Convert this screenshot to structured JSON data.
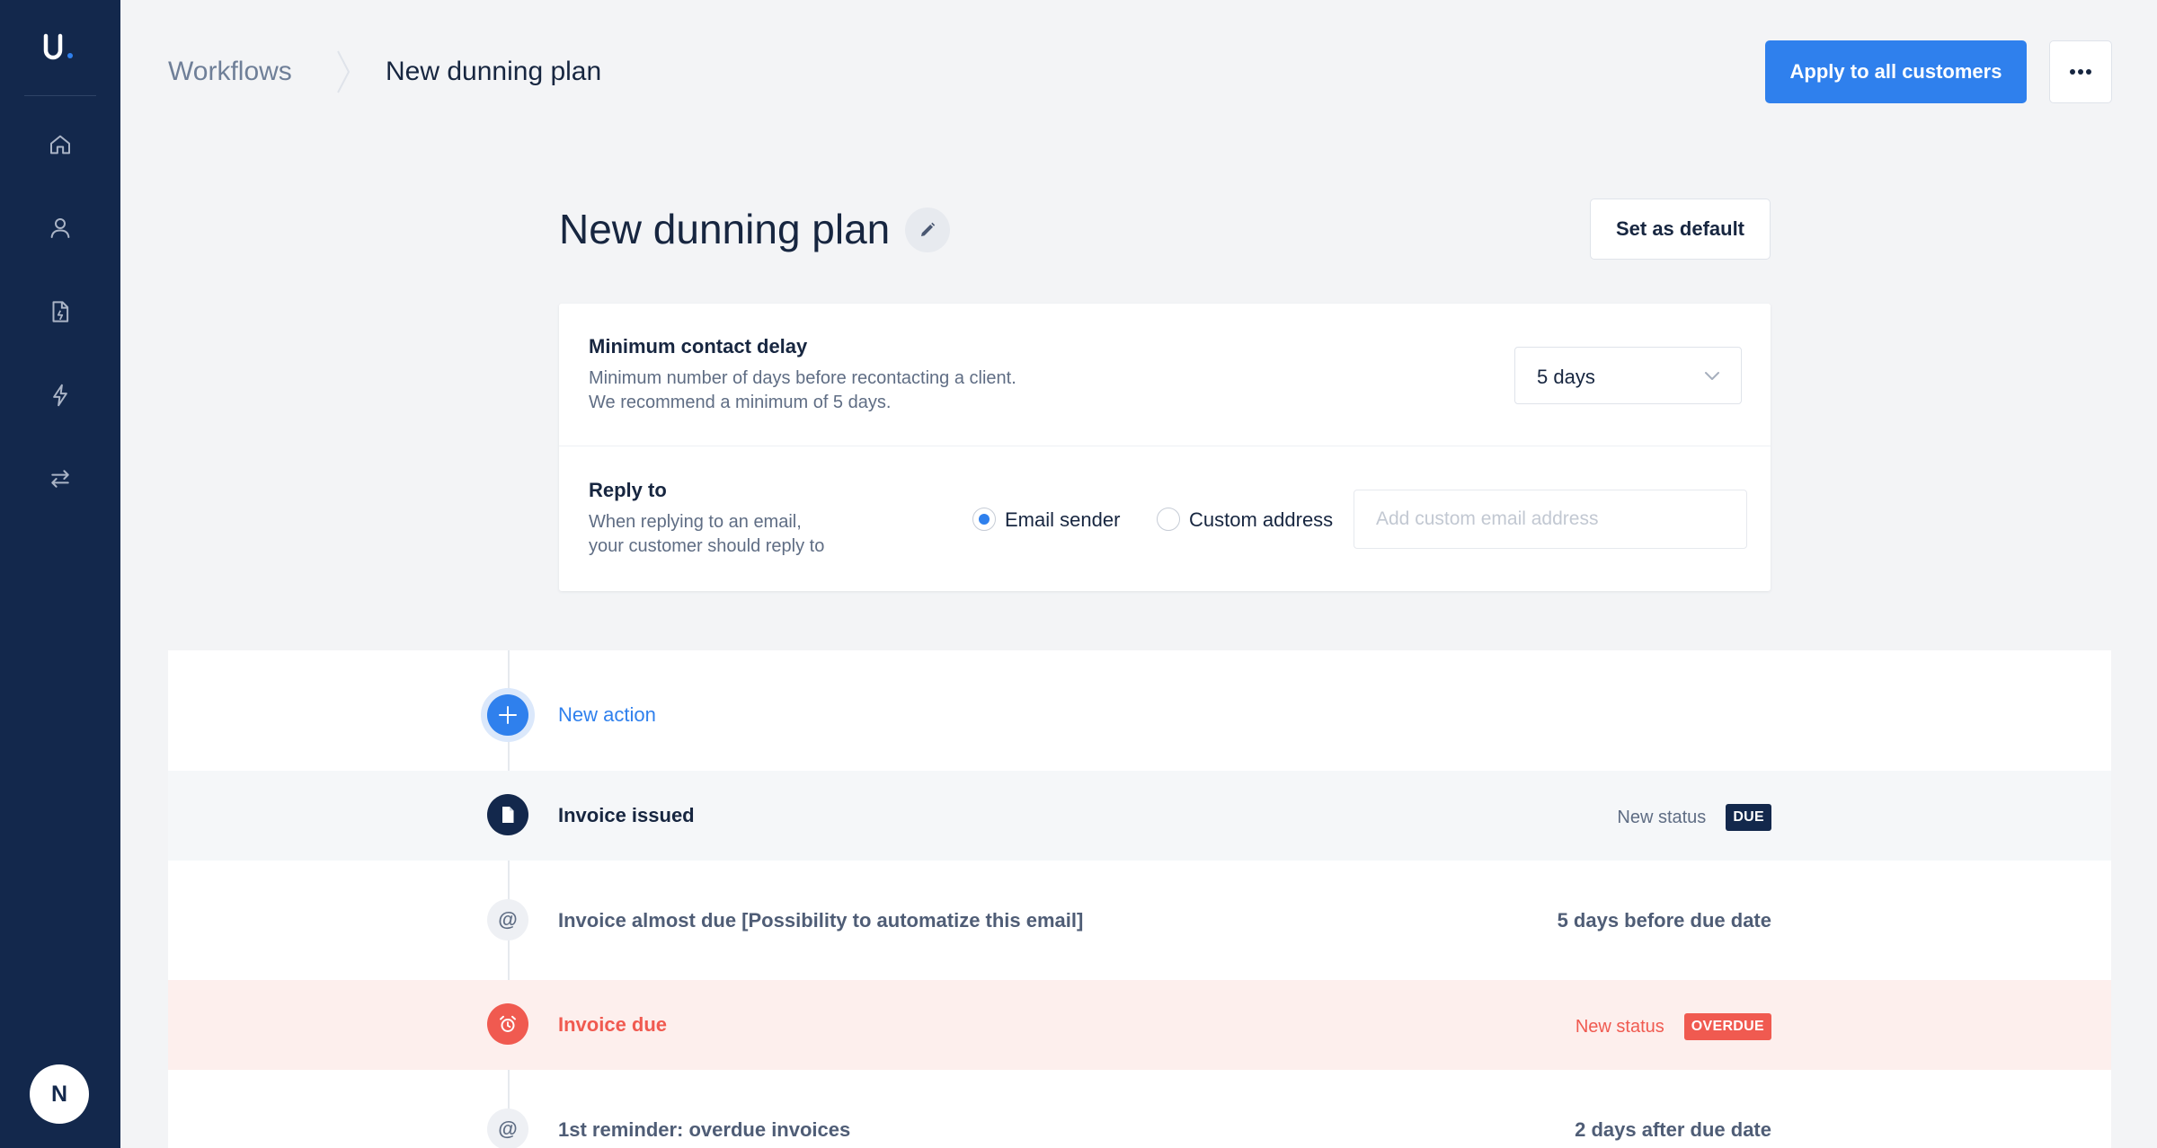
{
  "app": {
    "logo_text": "u.",
    "colors": {
      "sidebar": "#13284c",
      "accent": "#2f80ed",
      "danger": "#f05a50",
      "text": "#172640"
    }
  },
  "sidebar": {
    "items": [
      {
        "icon": "home-icon"
      },
      {
        "icon": "user-icon"
      },
      {
        "icon": "invoice-icon"
      },
      {
        "icon": "lightning-icon"
      },
      {
        "icon": "transfer-icon"
      }
    ],
    "avatar_initial": "N"
  },
  "header": {
    "breadcrumb_parent": "Workflows",
    "breadcrumb_current": "New dunning plan",
    "apply_button": "Apply to all customers",
    "more_icon": "more-horizontal-icon"
  },
  "plan": {
    "title": "New dunning plan",
    "edit_icon": "pencil-icon",
    "default_button": "Set as default"
  },
  "settings": {
    "delay": {
      "title": "Minimum contact delay",
      "desc_line1": "Minimum number of days before recontacting a client.",
      "desc_line2": "We recommend a minimum of 5 days.",
      "value": "5 days"
    },
    "reply": {
      "title": "Reply to",
      "desc_line1": "When replying to an email,",
      "desc_line2": "your customer should reply to",
      "option_sender": "Email sender",
      "option_custom": "Custom address",
      "selected": "Email sender",
      "custom_placeholder": "Add custom email address",
      "custom_value": ""
    }
  },
  "timeline": {
    "new_action": "New action",
    "steps": [
      {
        "label": "Invoice issued",
        "meta_text": "New status",
        "tag": "DUE",
        "icon": "document-icon"
      },
      {
        "label": "Invoice almost due [Possibility to automatize this email]",
        "meta_text": "5 days before due date",
        "icon": "at-icon"
      },
      {
        "label": "Invoice due",
        "meta_text": "New status",
        "tag": "OVERDUE",
        "icon": "alarm-clock-icon"
      },
      {
        "label": "1st reminder: overdue invoices",
        "meta_text": "2 days after due date",
        "icon": "at-icon"
      }
    ]
  }
}
